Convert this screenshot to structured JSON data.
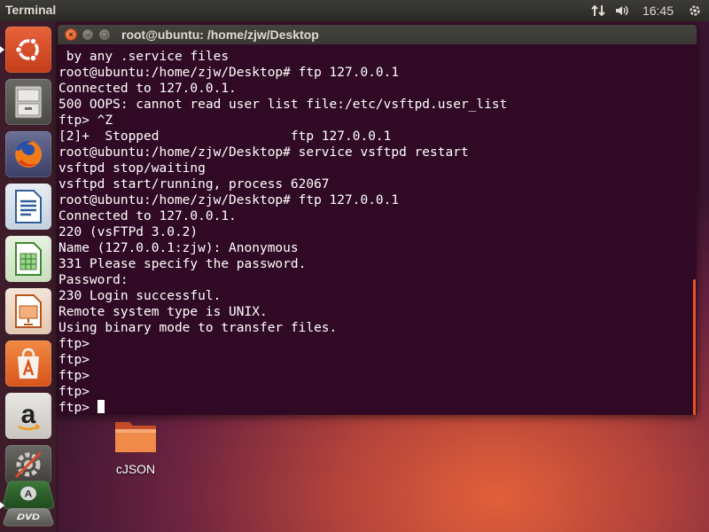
{
  "top_panel": {
    "title": "Terminal",
    "clock": "16:45",
    "icons": [
      "network-icon",
      "volume-icon",
      "power-gear-icon"
    ]
  },
  "launcher": {
    "items": [
      {
        "name": "ubuntu-dash",
        "icon": "ubuntu-logo-icon",
        "active": true
      },
      {
        "name": "files",
        "icon": "file-cabinet-icon"
      },
      {
        "name": "firefox",
        "icon": "firefox-icon"
      },
      {
        "name": "libreoffice-writer",
        "icon": "writer-icon"
      },
      {
        "name": "libreoffice-calc",
        "icon": "calc-icon"
      },
      {
        "name": "libreoffice-impress",
        "icon": "impress-icon"
      },
      {
        "name": "ubuntu-software",
        "icon": "software-center-icon"
      },
      {
        "name": "amazon",
        "icon": "amazon-icon"
      },
      {
        "name": "system-settings",
        "icon": "settings-icon"
      },
      {
        "name": "terminal",
        "icon": "terminal-icon"
      },
      {
        "name": "dvd",
        "icon": "dvd-icon"
      }
    ],
    "accent": "#e95420"
  },
  "window": {
    "title": "root@ubuntu: /home/zjw/Desktop",
    "background": "#300a24",
    "lines": [
      " by any .service files",
      "root@ubuntu:/home/zjw/Desktop# ftp 127.0.0.1",
      "Connected to 127.0.0.1.",
      "500 OOPS: cannot read user list file:/etc/vsftpd.user_list",
      "ftp> ^Z",
      "[2]+  Stopped                 ftp 127.0.0.1",
      "root@ubuntu:/home/zjw/Desktop# service vsftpd restart",
      "vsftpd stop/waiting",
      "vsftpd start/running, process 62067",
      "root@ubuntu:/home/zjw/Desktop# ftp 127.0.0.1",
      "Connected to 127.0.0.1.",
      "220 (vsFTPd 3.0.2)",
      "Name (127.0.0.1:zjw): Anonymous",
      "331 Please specify the password.",
      "Password:",
      "230 Login successful.",
      "Remote system type is UNIX.",
      "Using binary mode to transfer files.",
      "ftp>",
      "ftp>",
      "ftp>",
      "ftp>",
      "ftp> "
    ]
  },
  "desktop": {
    "folder_label": "cJSON"
  }
}
